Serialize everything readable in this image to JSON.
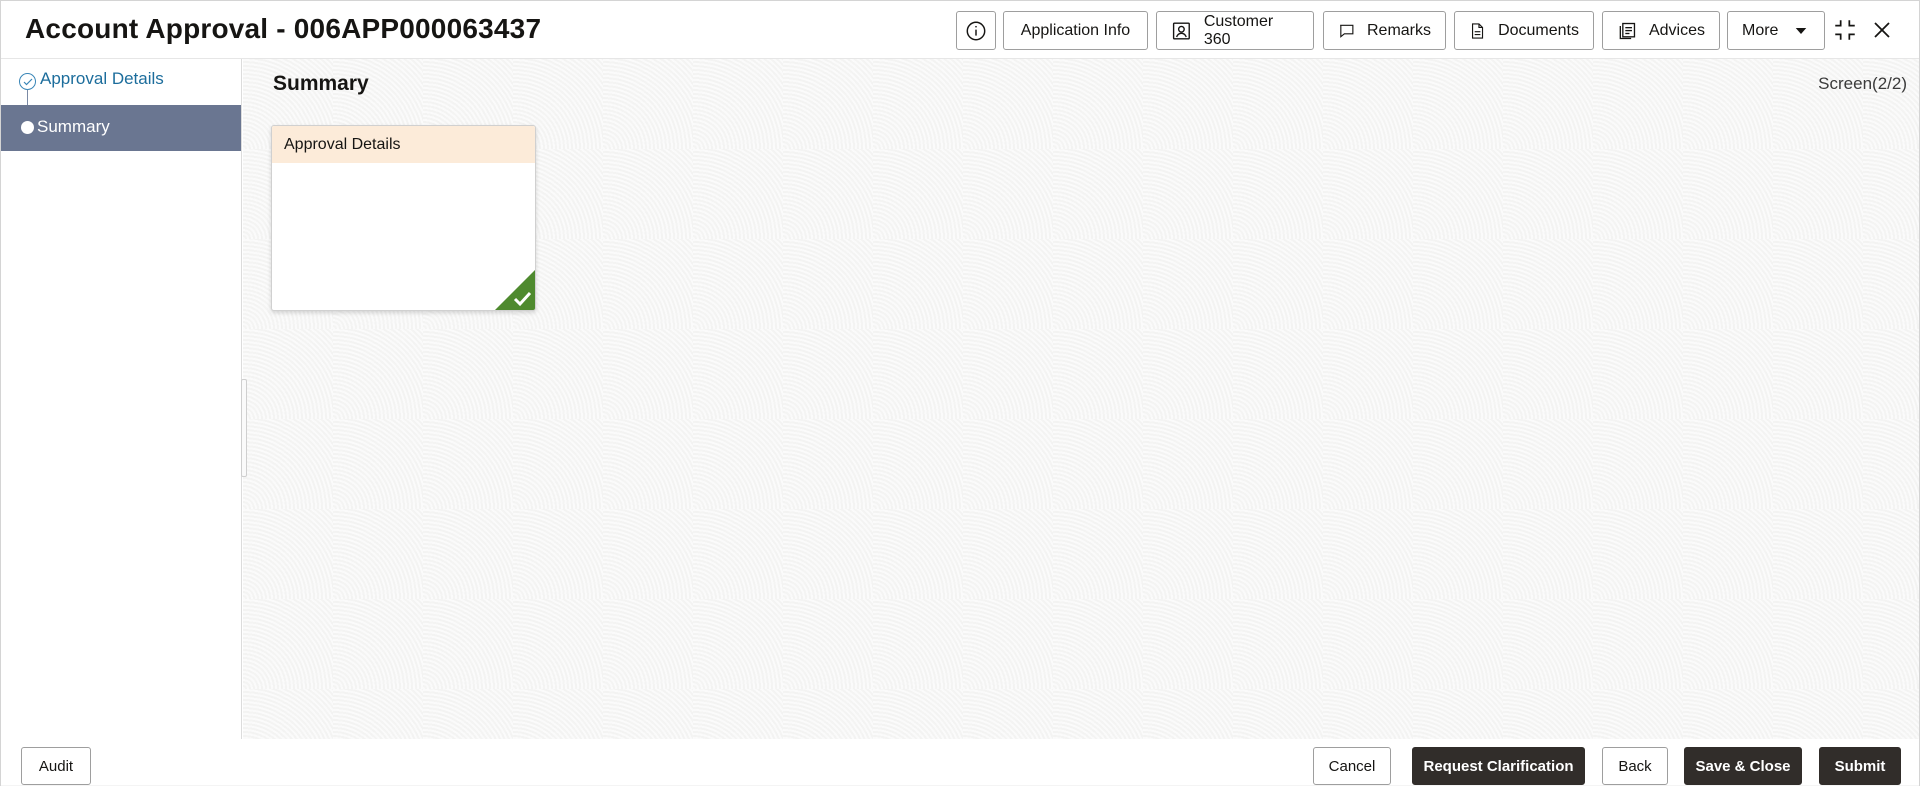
{
  "header": {
    "title": "Account Approval - 006APP000063437",
    "buttons": {
      "application_info": "Application Info",
      "customer_360": "Customer 360",
      "remarks": "Remarks",
      "documents": "Documents",
      "advices": "Advices",
      "more": "More"
    }
  },
  "sidebar": {
    "steps": [
      {
        "label": "Approval Details",
        "state": "completed"
      },
      {
        "label": "Summary",
        "state": "active"
      }
    ]
  },
  "main": {
    "heading": "Summary",
    "screen_counter": "Screen(2/2)",
    "cards": [
      {
        "title": "Approval Details",
        "status": "complete"
      }
    ]
  },
  "footer": {
    "audit": "Audit",
    "cancel": "Cancel",
    "request_clarification": "Request Clarification",
    "back": "Back",
    "save_close": "Save & Close",
    "submit": "Submit"
  },
  "colors": {
    "accent_dark": "#312d2a",
    "train_active": "#6a7691",
    "card_header": "#fcebd9",
    "success_green": "#4e8a2e",
    "link_blue": "#1c6d9c"
  }
}
